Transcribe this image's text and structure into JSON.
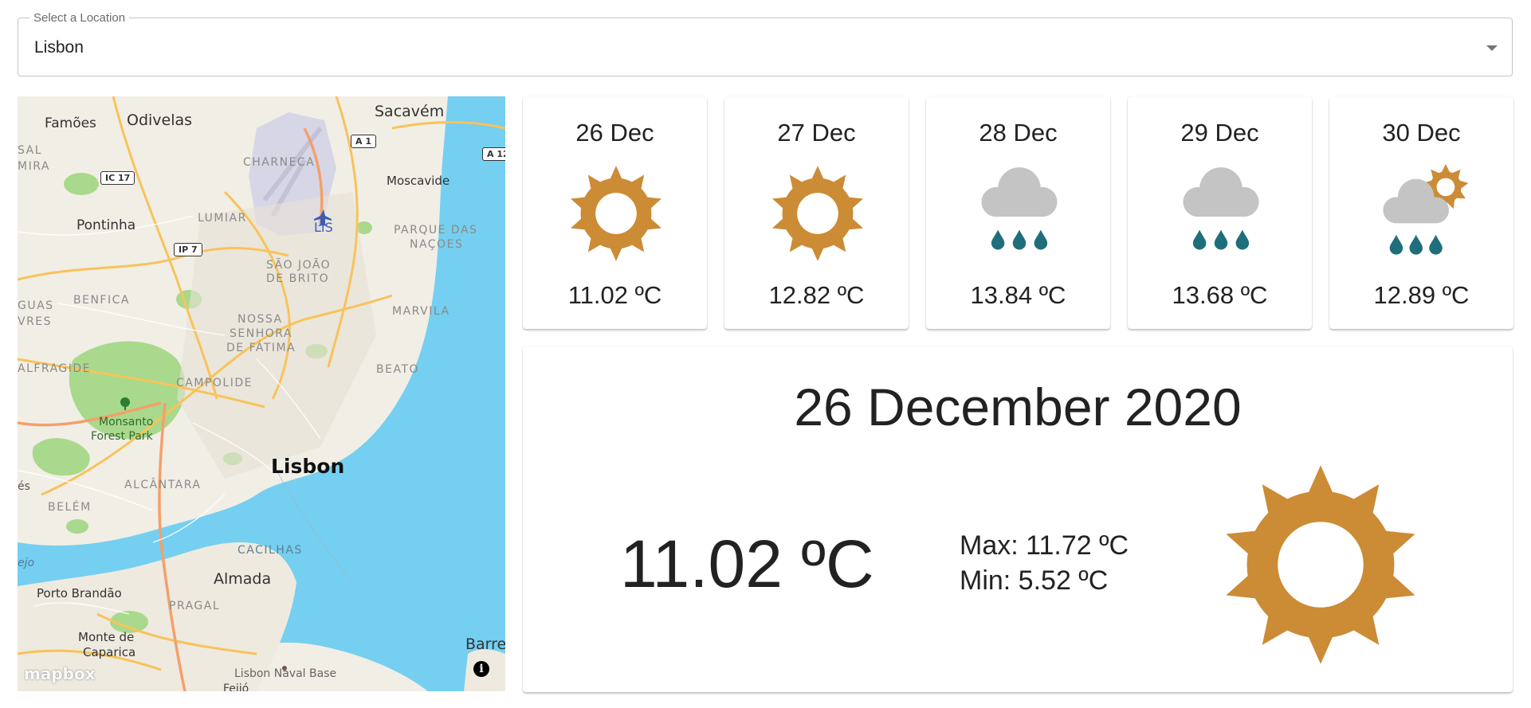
{
  "location_select": {
    "label": "Select a Location",
    "value": "Lisbon"
  },
  "map": {
    "labels": {
      "famoes": "Famões",
      "odivelas": "Odivelas",
      "sacavem": "Sacavém",
      "sal": "SAL",
      "mira": "MIRA",
      "charneca": "CHARNECA",
      "moscavide": "Moscavide",
      "pontinha": "Pontinha",
      "lumiar": "LUMIAR",
      "lis": "LIS",
      "parque1": "PARQUE DAS",
      "parque2": "NAÇOES",
      "sjb1": "SÃO JOÃO",
      "sjb2": "DE BRITO",
      "benfica": "BENFICA",
      "guas": "GUAS",
      "vres": "VRES",
      "marvila": "MARVILA",
      "nsf1": "NOSSA",
      "nsf2": "SENHORA",
      "nsf3": "DE FÁTIMA",
      "alfragide": "ALFRAGIDE",
      "beato": "BEATO",
      "campolide": "CAMPOLIDE",
      "monsanto1": "Monsanto",
      "monsanto2": "Forest Park",
      "lisbon": "Lisbon",
      "alcantara": "ALCÂNTARA",
      "es": "és",
      "belem": "BELÉM",
      "cacilhas": "CACILHAS",
      "tejo": "ejo",
      "almada": "Almada",
      "porto_brandao": "Porto Brandão",
      "pragal": "PRAGAL",
      "barre": "Barre",
      "monte1": "Monte de",
      "monte2": "Caparica",
      "naval_base": "Lisbon Naval Base",
      "feijo": "Feijó",
      "ic17": "IC 17",
      "a1": "A 1",
      "a12": "A 12",
      "ip7": "IP 7"
    },
    "attribution_logo": "mapbox",
    "info_button": "i",
    "colors": {
      "water": "#75cff0",
      "land": "#f1eee6",
      "park": "#a9d98c",
      "road": "#f8c35a"
    }
  },
  "forecast": [
    {
      "date": "26 Dec",
      "icon": "sun-icon",
      "temp": "11.02 ºC"
    },
    {
      "date": "27 Dec",
      "icon": "sun-icon",
      "temp": "12.82 ºC"
    },
    {
      "date": "28 Dec",
      "icon": "rain-cloud-icon",
      "temp": "13.84 ºC"
    },
    {
      "date": "29 Dec",
      "icon": "rain-cloud-icon",
      "temp": "13.68 ºC"
    },
    {
      "date": "30 Dec",
      "icon": "sun-rain-cloud-icon",
      "temp": "12.89 ºC"
    }
  ],
  "detail": {
    "date": "26 December 2020",
    "temp": "11.02 ºC",
    "max": "Max: 11.72 ºC",
    "min": "Min: 5.52 ºC",
    "icon": "sun-icon"
  },
  "colors": {
    "sun": "#cc8b35",
    "cloud": "#c4c4c4",
    "rain": "#1f6e7b"
  }
}
